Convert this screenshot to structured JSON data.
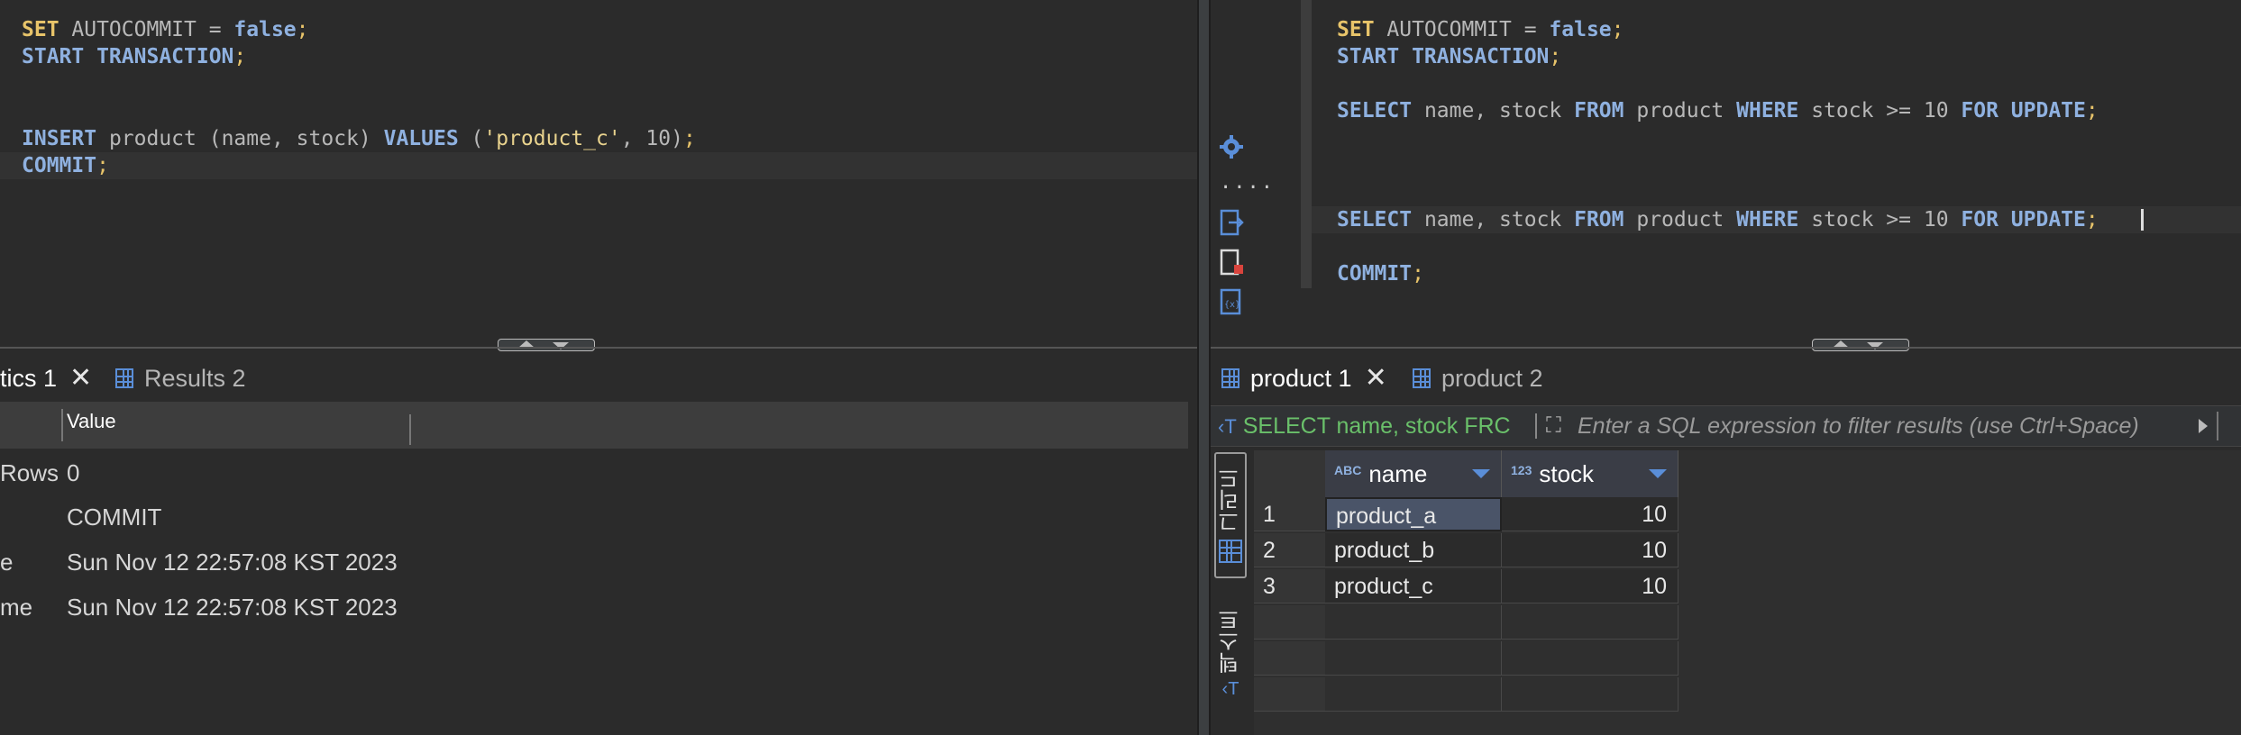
{
  "left": {
    "editor": {
      "lines": [
        {
          "tokens": [
            [
              "kwy",
              "SET"
            ],
            [
              "plain",
              " AUTOCOMMIT = "
            ],
            [
              "kw",
              "false"
            ],
            [
              "semi",
              ";"
            ]
          ]
        },
        {
          "tokens": [
            [
              "kw",
              "START TRANSACTION"
            ],
            [
              "semi",
              ";"
            ]
          ]
        },
        {
          "tokens": [
            [
              "kw",
              "INSERT"
            ],
            [
              "plain",
              " product (name, stock) "
            ],
            [
              "kw",
              "VALUES"
            ],
            [
              "plain",
              " ("
            ],
            [
              "str",
              "'product_c'"
            ],
            [
              "plain",
              ", 10)"
            ],
            [
              "semi",
              ";"
            ]
          ]
        },
        {
          "tokens": [
            [
              "kw",
              "COMMIT"
            ],
            [
              "semi",
              ";"
            ]
          ]
        }
      ]
    },
    "tabs": [
      {
        "label": "tics 1",
        "closable": true
      },
      {
        "label": "Results 2",
        "closable": false
      }
    ],
    "stats": {
      "header_value": "Value",
      "rows": [
        {
          "name": "Rows",
          "value": "0"
        },
        {
          "name": "",
          "value": "COMMIT"
        },
        {
          "name": "e",
          "value": "Sun Nov 12 22:57:08 KST 2023"
        },
        {
          "name": "me",
          "value": "Sun Nov 12 22:57:08 KST 2023"
        }
      ]
    }
  },
  "right": {
    "editor": {
      "lines": [
        {
          "tokens": [
            [
              "kwy",
              "SET"
            ],
            [
              "plain",
              " AUTOCOMMIT = "
            ],
            [
              "kw",
              "false"
            ],
            [
              "semi",
              ";"
            ]
          ]
        },
        {
          "tokens": [
            [
              "kw",
              "START TRANSACTION"
            ],
            [
              "semi",
              ";"
            ]
          ]
        },
        {
          "tokens": [
            [
              "kw",
              "SELECT"
            ],
            [
              "plain",
              " name, stock "
            ],
            [
              "kw",
              "FROM"
            ],
            [
              "plain",
              " product "
            ],
            [
              "kw",
              "WHERE"
            ],
            [
              "plain",
              " stock >= 10 "
            ],
            [
              "kw",
              "FOR UPDATE"
            ],
            [
              "semi",
              ";"
            ]
          ]
        },
        {
          "tokens": [
            [
              "kw",
              "SELECT"
            ],
            [
              "plain",
              " name, stock "
            ],
            [
              "kw",
              "FROM"
            ],
            [
              "plain",
              " product "
            ],
            [
              "kw",
              "WHERE"
            ],
            [
              "plain",
              " stock >= 10 "
            ],
            [
              "kw",
              "FOR UPDATE"
            ],
            [
              "semi",
              ";"
            ]
          ]
        },
        {
          "tokens": [
            [
              "kw",
              "COMMIT"
            ],
            [
              "semi",
              ";"
            ]
          ]
        }
      ]
    },
    "tool_icons": [
      "gear-icon",
      "more-icon",
      "execute-script-icon",
      "script-error-icon",
      "variables-icon"
    ],
    "tabs": [
      {
        "label": "product 1",
        "closable": true
      },
      {
        "label": "product 2",
        "closable": false
      }
    ],
    "filter": {
      "sql_text": "SELECT name, stock FRC",
      "placeholder": "Enter a SQL expression to filter results (use Ctrl+Space)"
    },
    "view_tabs": {
      "grid": "그리드",
      "text": "텍스트"
    },
    "columns": [
      {
        "type": "ABC",
        "name": "name"
      },
      {
        "type": "123",
        "name": "stock"
      }
    ],
    "rows": [
      {
        "num": "1",
        "name": "product_a",
        "stock": "10"
      },
      {
        "num": "2",
        "name": "product_b",
        "stock": "10"
      },
      {
        "num": "3",
        "name": "product_c",
        "stock": "10"
      }
    ],
    "empty_rows": 3
  }
}
